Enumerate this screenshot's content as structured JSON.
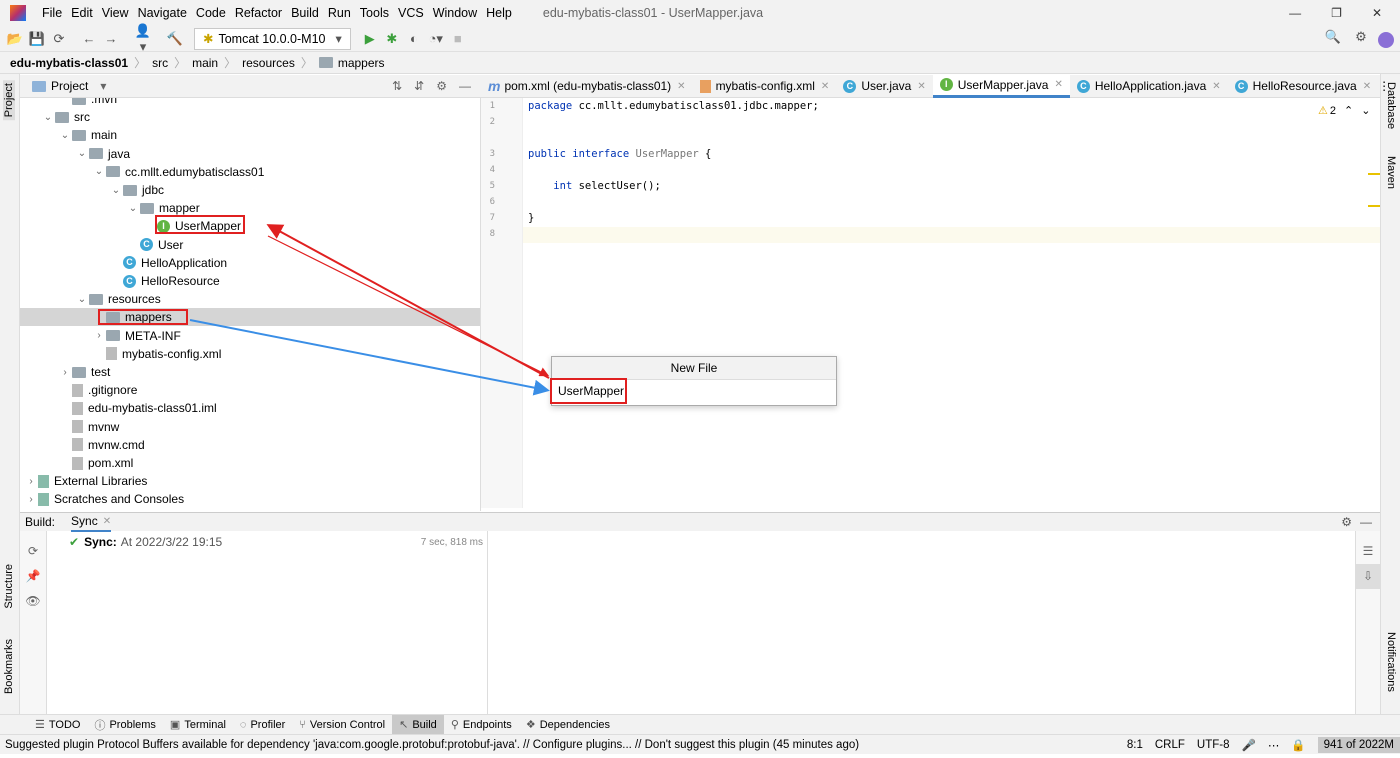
{
  "window": {
    "title": "edu-mybatis-class01 - UserMapper.java"
  },
  "menu": [
    "File",
    "Edit",
    "View",
    "Navigate",
    "Code",
    "Refactor",
    "Build",
    "Run",
    "Tools",
    "VCS",
    "Window",
    "Help"
  ],
  "toolbar": {
    "run_config": "Tomcat 10.0.0-M10"
  },
  "breadcrumb": [
    "edu-mybatis-class01",
    "src",
    "main",
    "resources",
    "mappers"
  ],
  "left_stripe": [
    "Project",
    "Structure",
    "Bookmarks"
  ],
  "right_stripe": [
    "Database",
    "Maven",
    "Notifications"
  ],
  "project": {
    "title": "Project",
    "tree": [
      {
        "label": ".mvn",
        "depth": 2,
        "type": "folder",
        "arrow": ""
      },
      {
        "label": "src",
        "depth": 1,
        "type": "folder",
        "arrow": "v"
      },
      {
        "label": "main",
        "depth": 2,
        "type": "folder",
        "arrow": "v"
      },
      {
        "label": "java",
        "depth": 3,
        "type": "folder",
        "arrow": "v"
      },
      {
        "label": "cc.mllt.edumybatisclass01",
        "depth": 4,
        "type": "folder",
        "arrow": "v"
      },
      {
        "label": "jdbc",
        "depth": 5,
        "type": "folder",
        "arrow": "v"
      },
      {
        "label": "mapper",
        "depth": 6,
        "type": "folder",
        "arrow": "v"
      },
      {
        "label": "UserMapper",
        "depth": 7,
        "type": "interface",
        "arrow": ""
      },
      {
        "label": "User",
        "depth": 6,
        "type": "class",
        "arrow": ""
      },
      {
        "label": "HelloApplication",
        "depth": 5,
        "type": "class",
        "arrow": ""
      },
      {
        "label": "HelloResource",
        "depth": 5,
        "type": "class",
        "arrow": ""
      },
      {
        "label": "resources",
        "depth": 3,
        "type": "folder",
        "arrow": "v"
      },
      {
        "label": "mappers",
        "depth": 4,
        "type": "folder",
        "arrow": "",
        "selected": true
      },
      {
        "label": "META-INF",
        "depth": 4,
        "type": "folder",
        "arrow": ">"
      },
      {
        "label": "mybatis-config.xml",
        "depth": 4,
        "type": "file",
        "arrow": ""
      },
      {
        "label": "test",
        "depth": 2,
        "type": "folder",
        "arrow": ">"
      },
      {
        "label": ".gitignore",
        "depth": 2,
        "type": "file",
        "arrow": ""
      },
      {
        "label": "edu-mybatis-class01.iml",
        "depth": 2,
        "type": "file",
        "arrow": ""
      },
      {
        "label": "mvnw",
        "depth": 2,
        "type": "file",
        "arrow": ""
      },
      {
        "label": "mvnw.cmd",
        "depth": 2,
        "type": "file",
        "arrow": ""
      },
      {
        "label": "pom.xml",
        "depth": 2,
        "type": "file",
        "arrow": ""
      },
      {
        "label": "External Libraries",
        "depth": 0,
        "type": "lib",
        "arrow": ">"
      },
      {
        "label": "Scratches and Consoles",
        "depth": 0,
        "type": "lib",
        "arrow": ">"
      }
    ]
  },
  "tabs": [
    {
      "label": "pom.xml (edu-mybatis-class01)",
      "icon": "m"
    },
    {
      "label": "mybatis-config.xml",
      "icon": "xml"
    },
    {
      "label": "User.java",
      "icon": "C"
    },
    {
      "label": "UserMapper.java",
      "icon": "I",
      "active": true
    },
    {
      "label": "HelloApplication.java",
      "icon": "C"
    },
    {
      "label": "HelloResource.java",
      "icon": "C"
    }
  ],
  "editor": {
    "warnings": "2",
    "lines": [
      {
        "n": "1",
        "text": "package cc.mllt.edumybatisclass01.jdbc.mapper;"
      },
      {
        "n": "2",
        "text": ""
      },
      {
        "n": "3",
        "text": "public interface UserMapper {"
      },
      {
        "n": "4",
        "text": ""
      },
      {
        "n": "5",
        "text": "    int selectUser();"
      },
      {
        "n": "6",
        "text": ""
      },
      {
        "n": "7",
        "text": "}"
      },
      {
        "n": "8",
        "text": ""
      }
    ]
  },
  "dialog": {
    "title": "New File",
    "value": "UserMapper"
  },
  "build": {
    "label": "Build:",
    "tab": "Sync",
    "sync_label": "Sync:",
    "sync_time": "At 2022/3/22 19:15",
    "duration": "7 sec, 818 ms"
  },
  "bottom_tabs": [
    "TODO",
    "Problems",
    "Terminal",
    "Profiler",
    "Version Control",
    "Build",
    "Endpoints",
    "Dependencies"
  ],
  "status": {
    "message": "Suggested plugin Protocol Buffers available for dependency 'java:com.google.protobuf:protobuf-java'. // Configure plugins... // Don't suggest this plugin (45 minutes ago)",
    "position": "8:1",
    "line_sep": "CRLF",
    "encoding": "UTF-8",
    "memory": "941 of 2022M"
  },
  "colors": {
    "accent": "#4083c9",
    "annotation_red": "#e02020",
    "annotation_blue": "#3a8ee6",
    "selection": "#d5d5d5"
  }
}
